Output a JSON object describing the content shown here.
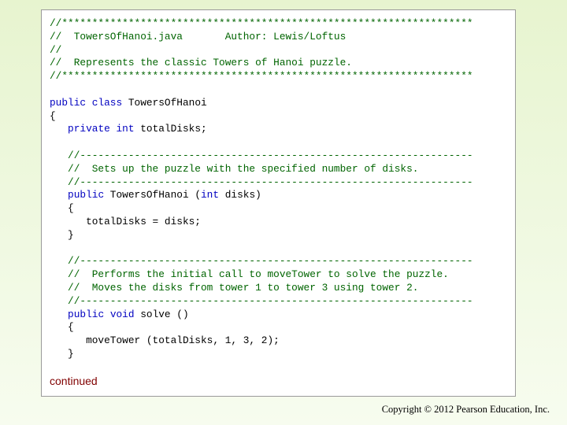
{
  "code_lines": [
    "//********************************************************************",
    "//  TowersOfHanoi.java       Author: Lewis/Loftus",
    "//",
    "//  Represents the classic Towers of Hanoi puzzle.",
    "//********************************************************************",
    "",
    "public class TowersOfHanoi",
    "{",
    "   private int totalDisks;",
    "",
    "   //-----------------------------------------------------------------",
    "   //  Sets up the puzzle with the specified number of disks.",
    "   //-----------------------------------------------------------------",
    "   public TowersOfHanoi (int disks)",
    "   {",
    "      totalDisks = disks;",
    "   }",
    "",
    "   //-----------------------------------------------------------------",
    "   //  Performs the initial call to moveTower to solve the puzzle.",
    "   //  Moves the disks from tower 1 to tower 3 using tower 2.",
    "   //-----------------------------------------------------------------",
    "   public void solve ()",
    "   {",
    "      moveTower (totalDisks, 1, 3, 2);",
    "   }"
  ],
  "continued_label": "continued",
  "copyright": "Copyright © 2012 Pearson Education, Inc.",
  "colors": {
    "comment": "#006400",
    "keyword": "#0000c0",
    "continued": "#800000"
  }
}
